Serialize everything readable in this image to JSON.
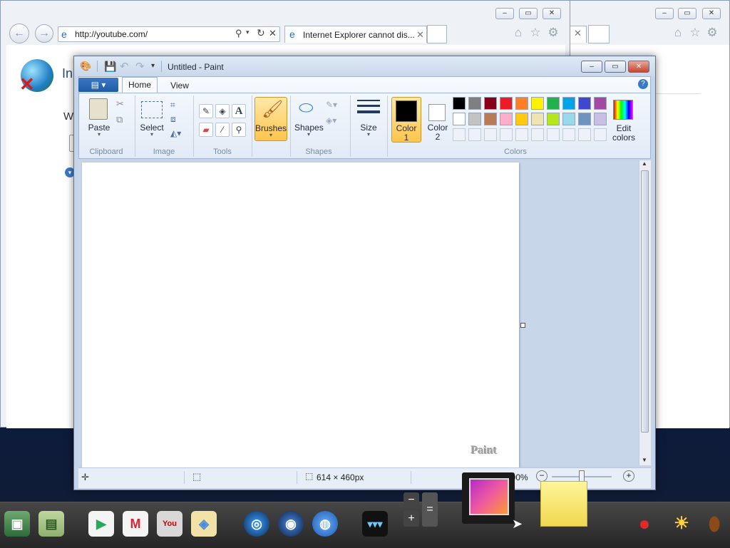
{
  "ie_back": {
    "tab1_title": "Internet Explorer cannot dis...",
    "address": "http://youtube.com/",
    "heading_partial": "In",
    "text_partial": "W"
  },
  "paint": {
    "title": "Untitled - Paint",
    "tabs": {
      "home": "Home",
      "view": "View"
    },
    "groups": {
      "clipboard": "Clipboard",
      "image": "Image",
      "tools": "Tools",
      "shapes": "Shapes",
      "colors": "Colors"
    },
    "buttons": {
      "paste": "Paste",
      "select": "Select",
      "brushes": "Brushes",
      "shapes": "Shapes",
      "size": "Size",
      "color1": "Color 1",
      "color1_a": "Color",
      "color1_b": "1",
      "color2_a": "Color",
      "color2_b": "2",
      "edit_colors_a": "Edit",
      "edit_colors_b": "colors"
    },
    "color1_value": "#000000",
    "color2_value": "#ffffff",
    "palette": [
      "#000000",
      "#7f7f7f",
      "#880015",
      "#ed1c24",
      "#ff7f27",
      "#fff200",
      "#22b14c",
      "#00a2e8",
      "#3f48cc",
      "#a349a4",
      "#ffffff",
      "#c3c3c3",
      "#b97a57",
      "#ffaec9",
      "#ffc90e",
      "#efe4b0",
      "#b5e61d",
      "#99d9ea",
      "#7092be",
      "#c8bfe7"
    ],
    "canvas_watermark": "Paint",
    "status": {
      "size": "614 × 460px",
      "zoom": "100%"
    }
  },
  "taskbar": {
    "calc": {
      "minus": "−",
      "plus": "+",
      "equals": "="
    }
  }
}
